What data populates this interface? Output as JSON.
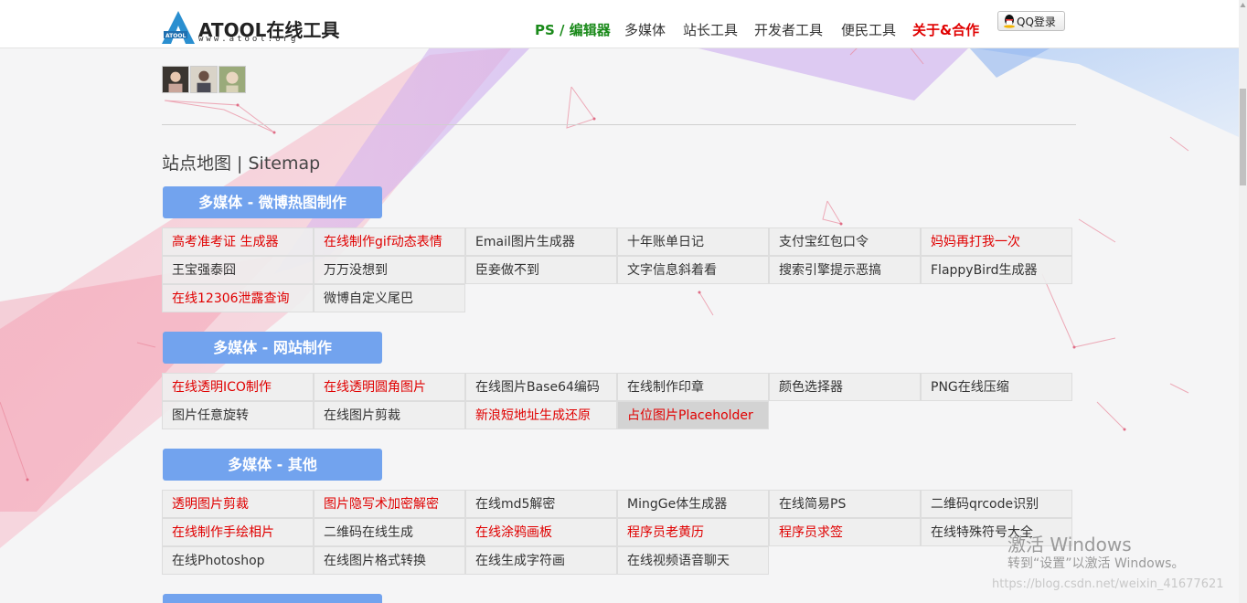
{
  "header": {
    "logo_title": "ATOOL在线工具",
    "logo_sub": "www.atool.org",
    "nav": [
      {
        "label": "PS / 编辑器",
        "style": "green"
      },
      {
        "label": "多媒体",
        "style": "normal"
      },
      {
        "label": "站长工具",
        "style": "normal"
      },
      {
        "label": "开发者工具",
        "style": "normal"
      },
      {
        "label": "便民工具",
        "style": "normal"
      },
      {
        "label": "关于&合作",
        "style": "red"
      }
    ],
    "qq_login": "QQ登录"
  },
  "sitemap_title": "站点地图 | Sitemap",
  "sections": [
    {
      "title": "多媒体 - 微博热图制作",
      "items": [
        {
          "label": "高考准考证 生成器",
          "red": true
        },
        {
          "label": "在线制作gif动态表情",
          "red": true
        },
        {
          "label": "Email图片生成器",
          "red": false
        },
        {
          "label": "十年账单日记",
          "red": false
        },
        {
          "label": "支付宝红包口令",
          "red": false
        },
        {
          "label": "妈妈再打我一次",
          "red": true
        },
        {
          "label": "王宝强泰囧",
          "red": false
        },
        {
          "label": "万万没想到",
          "red": false
        },
        {
          "label": "臣妾做不到",
          "red": false
        },
        {
          "label": "文字信息斜着看",
          "red": false
        },
        {
          "label": "搜索引擎提示恶搞",
          "red": false
        },
        {
          "label": "FlappyBird生成器",
          "red": false
        },
        {
          "label": "在线12306泄露查询",
          "red": true
        },
        {
          "label": "微博自定义尾巴",
          "red": false
        }
      ]
    },
    {
      "title": "多媒体 - 网站制作",
      "items": [
        {
          "label": "在线透明ICO制作",
          "red": true
        },
        {
          "label": "在线透明圆角图片",
          "red": true
        },
        {
          "label": "在线图片Base64编码",
          "red": false
        },
        {
          "label": "在线制作印章",
          "red": false
        },
        {
          "label": "颜色选择器",
          "red": false
        },
        {
          "label": "PNG在线压缩",
          "red": false
        },
        {
          "label": "图片任意旋转",
          "red": false
        },
        {
          "label": "在线图片剪裁",
          "red": false
        },
        {
          "label": "新浪短地址生成还原",
          "red": true
        },
        {
          "label": "占位图片Placeholder",
          "red": true,
          "highlight": true
        }
      ]
    },
    {
      "title": "多媒体 - 其他",
      "items": [
        {
          "label": "透明图片剪裁",
          "red": true
        },
        {
          "label": "图片隐写术加密解密",
          "red": true
        },
        {
          "label": "在线md5解密",
          "red": false
        },
        {
          "label": "MingGe体生成器",
          "red": false
        },
        {
          "label": "在线简易PS",
          "red": false
        },
        {
          "label": "二维码qrcode识别",
          "red": false
        },
        {
          "label": "在线制作手绘相片",
          "red": true
        },
        {
          "label": "二维码在线生成",
          "red": false
        },
        {
          "label": "在线涂鸦画板",
          "red": true
        },
        {
          "label": "程序员老黄历",
          "red": true
        },
        {
          "label": "程序员求签",
          "red": true
        },
        {
          "label": "在线特殊符号大全",
          "red": false
        },
        {
          "label": "在线Photoshop",
          "red": false
        },
        {
          "label": "在线图片格式转换",
          "red": false
        },
        {
          "label": "在线生成字符画",
          "red": false
        },
        {
          "label": "在线视频语音聊天",
          "red": false
        }
      ]
    }
  ],
  "watermark": {
    "line1": "激活 Windows",
    "line2": "转到“设置”以激活 Windows。",
    "csdn": "https://blog.csdn.net/weixin_41677621"
  },
  "colors": {
    "section_button": "#72a3ee",
    "red_link": "#e00000",
    "green_nav": "#1a8a1a"
  }
}
